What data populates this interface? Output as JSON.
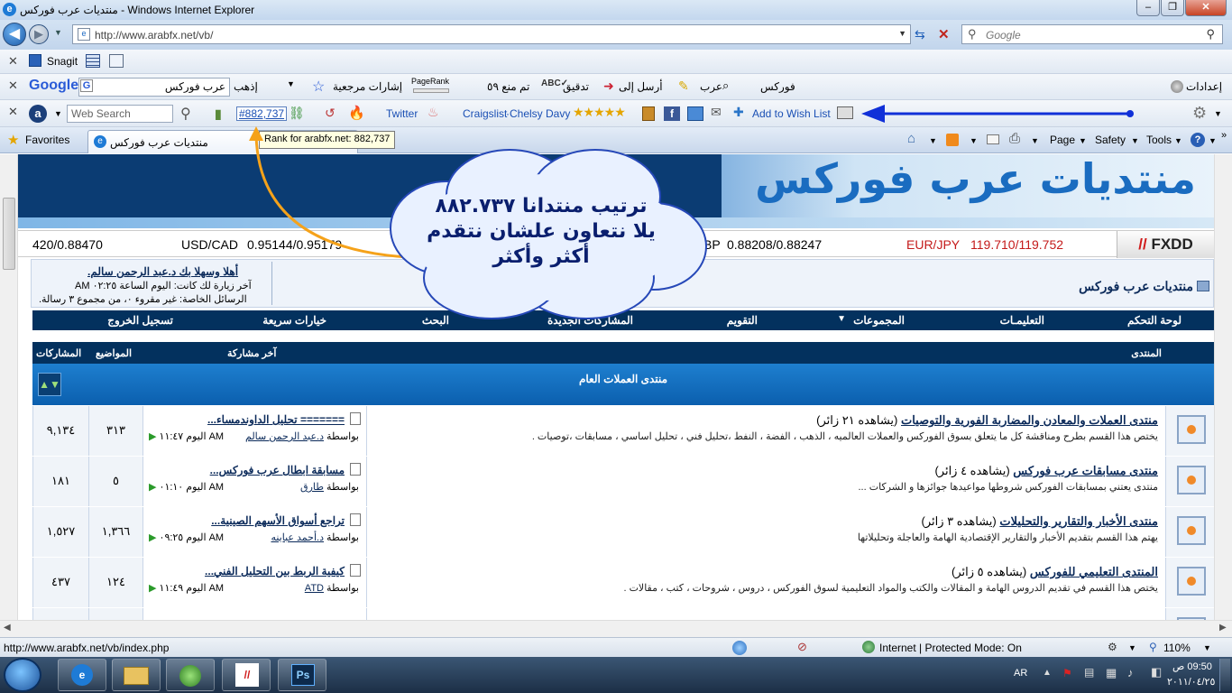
{
  "window": {
    "title": "منتديات عرب فوركس - Windows Internet Explorer"
  },
  "address": {
    "url": "http://www.arabfx.net/vb/",
    "search_placeholder": "Google"
  },
  "toolbar_snagit": {
    "label": "Snagit"
  },
  "toolbar_google": {
    "logo": "Google",
    "search_value": "عرب فوركس",
    "go": "إذهب",
    "bookmarks": "إشارات مرجعية",
    "pagerank": "PageRank",
    "blocked": "تم منع ٥٩",
    "check": "تدقيق",
    "send": "أرسل إلى",
    "arab": "عرب",
    "forex": "فوركس",
    "settings": "إعدادات"
  },
  "toolbar_web": {
    "search_placeholder": "Web Search",
    "rank_link": "#882,737",
    "twitter": "Twitter",
    "craigslist": "Craigslist",
    "chelsy": "Chelsy Davy",
    "wishlist": "Add to Wish List"
  },
  "favbar": {
    "favorites": "Favorites",
    "tab_title": "منتديات عرب فوركس",
    "tooltip": "Rank for arabfx.net: 882,737",
    "page": "Page",
    "safety": "Safety",
    "tools": "Tools"
  },
  "callout": {
    "line1": "ترتيب منتدانا ٨٨٢.٧٣٧",
    "line2": "يلا نتعاون علشان نتقدم",
    "line3": "أكثر وأكثر"
  },
  "ticker": {
    "left_rate": "420/0.88470",
    "usdcad_label": "USD/CAD",
    "usdcad_rate": "0.95144/0.95179",
    "gbp_label": "BP",
    "gbp_rate": "0.88208/0.88247",
    "eurjpy_label": "EUR/JPY",
    "eurjpy_rate": "119.710/119.752",
    "brand": "FXDD"
  },
  "banner": {
    "logo_text": "منتديات عرب فوركس"
  },
  "welcome": {
    "greeting": "أهلا وسهلا بك د.عبد الرحمن سالم.",
    "last_visit": "آخر زيارة لك كانت: اليوم الساعة ٠٢:٢٥ AM",
    "pm": "الرسائل الخاصة: غير مقروء ٠، من مجموع ٣ رسالة.",
    "forum_name": "منتديات عرب فوركس"
  },
  "nav": {
    "items": [
      "لوحة التحكم",
      "التعليمـات",
      "المجموعات",
      "التقويم",
      "المشاركات الجديدة",
      "البحث",
      "خيارات سريعة",
      "تسجيل الخروج"
    ]
  },
  "table": {
    "headers": {
      "forum": "المنتدى",
      "last_post": "آخر مشاركة",
      "threads": "المواضيع",
      "posts": "المشاركات"
    },
    "section_title": "منتدى العملات العام",
    "rows": [
      {
        "title": "منتدى العملات والمعادن والمضاربة الفورية والتوصيات",
        "viewers": "(يشاهده ٢١ زائر)",
        "desc": "يختص هذا القسم بطرح ومناقشة كل ما يتعلق بسوق الفوركس والعملات العالميه ، الذهب ، الفضة ، النفط ،تحليل فني ، تحليل اساسي ، مسابقات ،توصيات .",
        "last_title": "======= تحليل الداوندمساء...",
        "by_label": "بواسطة",
        "last_by": "د.عبد الرحمن سالم",
        "last_date": "اليوم ١١:٤٧ AM",
        "threads": "٣١٣",
        "posts": "٩,١٣٤"
      },
      {
        "title": "منتدى مسابقات عرب فوركس",
        "viewers": "(يشاهده ٤ زائر)",
        "desc": "منتدى يعتني بمسابقات الفوركس شروطها مواعيدها جوائزها و الشركات ...",
        "last_title": "مسابقة ابطال عرب فوركس...",
        "by_label": "بواسطة",
        "last_by": "طارق",
        "last_date": "اليوم ٠١:١٠ AM",
        "threads": "٥",
        "posts": "١٨١"
      },
      {
        "title": "منتدى الأخبار والتقارير والتحليلات",
        "viewers": "(يشاهده ٣ زائر)",
        "desc": "يهتم هذا القسم بتقديم الأخبار والتقارير الإقتصادية الهامة والعاجلة وتحليلاتها",
        "last_title": "تراجع أسواق الأسهم الصينية...",
        "by_label": "بواسطة",
        "last_by": "د.أحمد عباينه",
        "last_date": "اليوم ٠٩:٢٥ AM",
        "threads": "١,٣٦٦",
        "posts": "١,٥٢٧"
      },
      {
        "title": "المنتدى التعليمي للفوركس",
        "viewers": "(يشاهده ٥ زائر)",
        "desc": "يختص هذا القسم في تقديم الدروس الهامة و المقالات والكتب والمواد التعليمية لسوق الفوركس ، دروس ، شروحات ، كتب ، مقالات .",
        "last_title": "كيفية الربط بين التحليل الفني...",
        "by_label": "بواسطة",
        "last_by": "ATD",
        "last_date": "اليوم ١١:٤٩ AM",
        "threads": "١٢٤",
        "posts": "٤٣٧"
      }
    ]
  },
  "status": {
    "url": "http://www.arabfx.net/vb/index.php",
    "zone": "Internet | Protected Mode: On",
    "zoom": "110%"
  },
  "taskbar": {
    "lang": "AR",
    "time": "09:50 ص",
    "date": "٢٠١١/٠٤/٢٥"
  }
}
